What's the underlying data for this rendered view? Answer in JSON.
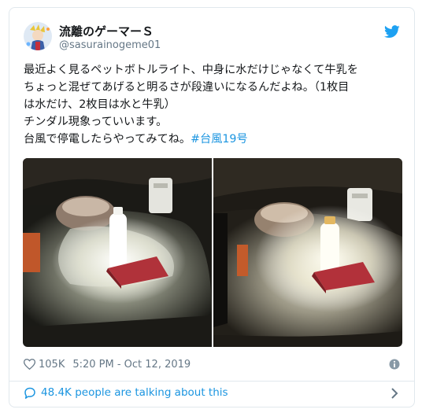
{
  "author": {
    "display_name": "流離のゲーマーＳ",
    "handle": "@sasurainogeme01"
  },
  "tweet": {
    "text_line1": "最近よく見るペットボトルライト、中身に水だけじゃなくて牛乳を",
    "text_line2": "ちょっと混ぜてあげると明るさが段違いになるんだよね。（1枚目",
    "text_line3": "は水だけ、2枚目は水と牛乳）",
    "text_line4": "チンダル現象っていいます。",
    "text_line5_pre": "台風で停電したらやってみてね。",
    "hashtag": "#台風19号"
  },
  "stats": {
    "likes": "105K",
    "timestamp": "5:20 PM - Oct 12, 2019"
  },
  "footer": {
    "talking": "48.4K people are talking about this"
  },
  "colors": {
    "brand": "#1da1f2",
    "link": "#1b95e0",
    "muted": "#657786"
  },
  "icons": [
    "twitter-bird-icon",
    "heart-icon",
    "info-icon",
    "reply-bubble-icon",
    "chevron-right-icon"
  ]
}
